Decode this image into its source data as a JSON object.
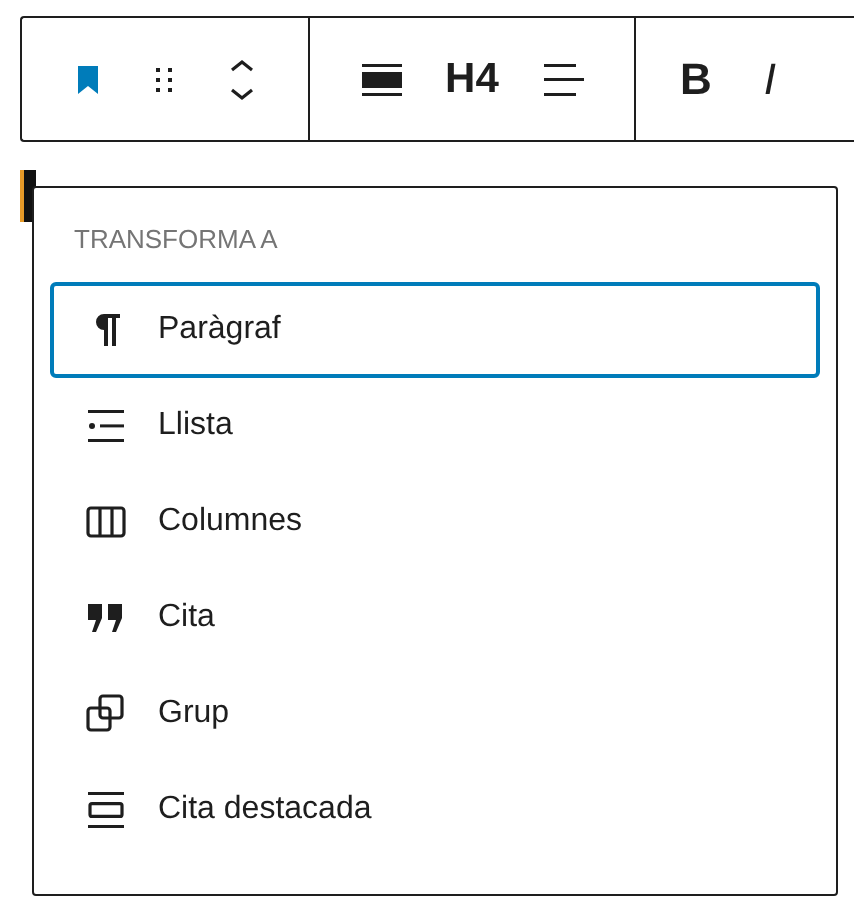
{
  "toolbar": {
    "groups": [
      {
        "items": [
          {
            "kind": "block-icon"
          },
          {
            "kind": "drag"
          },
          {
            "kind": "mover"
          }
        ]
      },
      {
        "items": [
          {
            "kind": "align"
          },
          {
            "kind": "heading",
            "label": "H4"
          },
          {
            "kind": "text-align"
          }
        ]
      },
      {
        "items": [
          {
            "kind": "bold",
            "label": "B"
          },
          {
            "kind": "italic",
            "label": "I"
          }
        ]
      }
    ]
  },
  "menu": {
    "title": "TRANSFORMA A",
    "items": [
      {
        "label": "Paràgraf",
        "kind": "paragraph",
        "selected": true
      },
      {
        "label": "Llista",
        "kind": "list",
        "selected": false
      },
      {
        "label": "Columnes",
        "kind": "columns",
        "selected": false
      },
      {
        "label": "Cita",
        "kind": "quote",
        "selected": false
      },
      {
        "label": "Grup",
        "kind": "group",
        "selected": false
      },
      {
        "label": "Cita destacada",
        "kind": "pullquote",
        "selected": false
      }
    ]
  }
}
